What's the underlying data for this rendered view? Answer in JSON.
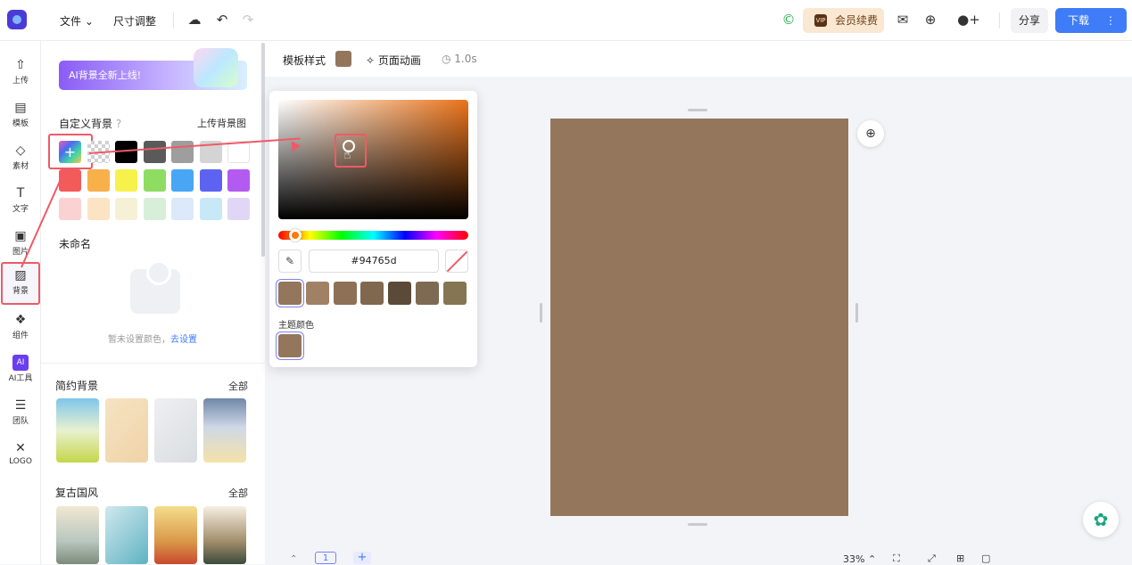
{
  "topbar": {
    "file_menu": "文件 ⌄",
    "resize": "尺寸调整",
    "vip_badge": "VIP",
    "vip_label": "会员续费",
    "share": "分享",
    "download": "下载",
    "download_more": "⋮"
  },
  "rail": [
    {
      "label": "上传",
      "icon": "upload-icon",
      "glyph": "⇧"
    },
    {
      "label": "模板",
      "icon": "template-icon",
      "glyph": "▤"
    },
    {
      "label": "素材",
      "icon": "elements-icon",
      "glyph": "◇"
    },
    {
      "label": "文字",
      "icon": "text-icon",
      "glyph": "T"
    },
    {
      "label": "图片",
      "icon": "image-icon",
      "glyph": "▣"
    },
    {
      "label": "背景",
      "icon": "background-icon",
      "glyph": "▨"
    },
    {
      "label": "组件",
      "icon": "components-icon",
      "glyph": "❖"
    },
    {
      "label": "AI工具",
      "icon": "ai-tools-icon",
      "glyph": "AI"
    },
    {
      "label": "团队",
      "icon": "team-icon",
      "glyph": "☰"
    },
    {
      "label": "LOGO",
      "icon": "logo-tool-icon",
      "glyph": "✕"
    }
  ],
  "panel": {
    "banner_ai": "AI背景",
    "banner_text": "全新上线!",
    "custom_bg_title": "自定义背景",
    "upload_bg": "上传背景图",
    "colors_row1": [
      "#000000",
      "#5a5a5a",
      "#9e9e9e",
      "#d4d4d4",
      "#ffffff"
    ],
    "colors_row2": [
      "#f35b5b",
      "#f8b04b",
      "#f6f24b",
      "#8fdc62",
      "#48a6f5",
      "#5d63f0",
      "#b35bf0"
    ],
    "colors_row3": [
      "#fbd2d2",
      "#fbe4c4",
      "#f6f1d6",
      "#d7efd9",
      "#dbe9fb",
      "#c7e8f7",
      "#e2d6f6"
    ],
    "unnamed": "未命名",
    "empty_text": "暂未设置颜色，",
    "empty_link": "去设置",
    "simple_bg_title": "简约背景",
    "simple_all": "全部",
    "retro_title": "复古国风",
    "retro_all": "全部"
  },
  "toolbar2": {
    "template_style": "模板样式",
    "page_anim": "页面动画",
    "duration": "1.0s"
  },
  "picker": {
    "hex": "#94765d",
    "presets": [
      "#94765d",
      "#a08166",
      "#8e7056",
      "#80684e",
      "#5c4a39",
      "#7e6a52",
      "#857553"
    ],
    "theme_title": "主题颜色",
    "theme_color": "#94765d"
  },
  "canvas": {
    "page_color": "#94765d"
  },
  "bottom": {
    "zoom": "33% ⌃",
    "page_num": "1",
    "add_page": "+"
  },
  "colors": {
    "accent": "#3f7cf7",
    "highlight": "#ee5a67"
  }
}
